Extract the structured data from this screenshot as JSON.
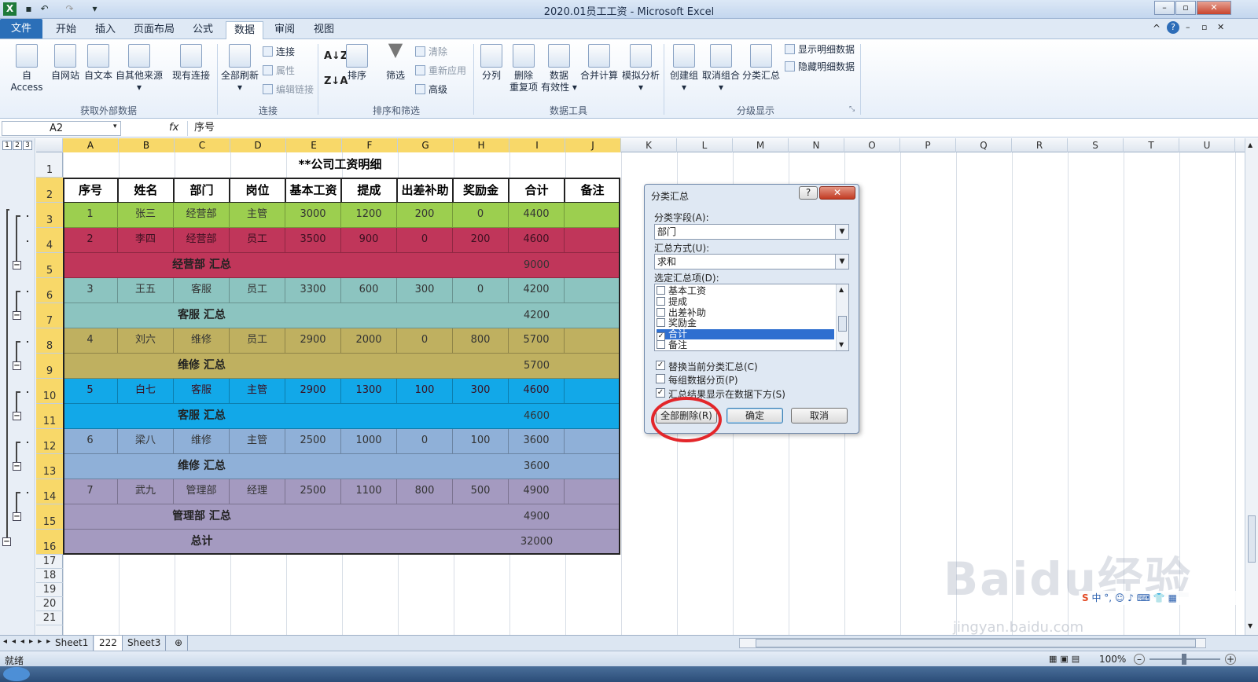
{
  "window": {
    "title": "2020.01员工工资 - Microsoft Excel"
  },
  "tabs": [
    "文件",
    "开始",
    "插入",
    "页面布局",
    "公式",
    "数据",
    "审阅",
    "视图"
  ],
  "active_tab": "数据",
  "ribbon": {
    "external": {
      "access": "自 Access",
      "web": "自网站",
      "text": "自文本",
      "other": "自其他来源",
      "existing": "现有连接",
      "group": "获取外部数据"
    },
    "connections": {
      "refresh_all": "全部刷新",
      "connections": "连接",
      "properties": "属性",
      "edit_links": "编辑链接",
      "group": "连接"
    },
    "sort_filter": {
      "sort": "排序",
      "filter": "筛选",
      "clear": "清除",
      "reapply": "重新应用",
      "advanced": "高级",
      "group": "排序和筛选"
    },
    "data_tools": {
      "split": "分列",
      "remove_dup_1": "删除",
      "remove_dup_2": "重复项",
      "valid_1": "数据",
      "valid_2": "有效性",
      "consolidate": "合并计算",
      "whatif": "模拟分析",
      "group": "数据工具"
    },
    "outline": {
      "group_btn": "创建组",
      "ungroup": "取消组合",
      "subtotal": "分类汇总",
      "show_detail": "显示明细数据",
      "hide_detail": "隐藏明细数据",
      "group": "分级显示"
    }
  },
  "formula_bar": {
    "name_box": "A2",
    "fx": "fx",
    "value": "序号"
  },
  "outline_levels": [
    "1",
    "2",
    "3"
  ],
  "columns": [
    "A",
    "B",
    "C",
    "D",
    "E",
    "F",
    "G",
    "H",
    "I",
    "J",
    "K",
    "L",
    "M",
    "N",
    "O",
    "P",
    "Q",
    "R",
    "S",
    "T",
    "U"
  ],
  "rows": [
    "1",
    "2",
    "3",
    "4",
    "5",
    "6",
    "7",
    "8",
    "9",
    "10",
    "11",
    "12",
    "13",
    "14",
    "15",
    "16",
    "17",
    "18",
    "19",
    "20",
    "21"
  ],
  "sheet": {
    "title": "**公司工资明细",
    "headers": [
      "序号",
      "姓名",
      "部门",
      "岗位",
      "基本工资",
      "提成",
      "出差补助",
      "奖励金",
      "合计",
      "备注"
    ],
    "data_rows": [
      {
        "cells": [
          "1",
          "张三",
          "经营部",
          "主管",
          "3000",
          "1200",
          "200",
          "0",
          "4400",
          ""
        ],
        "color": "#9ccf4f"
      },
      {
        "cells": [
          "2",
          "李四",
          "经营部",
          "员工",
          "3500",
          "900",
          "0",
          "200",
          "4600",
          ""
        ],
        "color": "#c0365a"
      },
      {
        "subtotal": "经营部 汇总",
        "total": "9000",
        "color": "#c0365a"
      },
      {
        "cells": [
          "3",
          "王五",
          "客服",
          "员工",
          "3300",
          "600",
          "300",
          "0",
          "4200",
          ""
        ],
        "color": "#8cc4c0"
      },
      {
        "subtotal": "客服 汇总",
        "total": "4200",
        "color": "#8cc4c0"
      },
      {
        "cells": [
          "4",
          "刘六",
          "维修",
          "员工",
          "2900",
          "2000",
          "0",
          "800",
          "5700",
          ""
        ],
        "color": "#bfb060"
      },
      {
        "subtotal": "维修 汇总",
        "total": "5700",
        "color": "#bfb060"
      },
      {
        "cells": [
          "5",
          "白七",
          "客服",
          "主管",
          "2900",
          "1300",
          "100",
          "300",
          "4600",
          ""
        ],
        "color": "#12a8e8"
      },
      {
        "subtotal": "客服 汇总",
        "total": "4600",
        "color": "#12a8e8"
      },
      {
        "cells": [
          "6",
          "梁八",
          "维修",
          "主管",
          "2500",
          "1000",
          "0",
          "100",
          "3600",
          ""
        ],
        "color": "#8fb0d8"
      },
      {
        "subtotal": "维修 汇总",
        "total": "3600",
        "color": "#8fb0d8"
      },
      {
        "cells": [
          "7",
          "武九",
          "管理部",
          "经理",
          "2500",
          "1100",
          "800",
          "500",
          "4900",
          ""
        ],
        "color": "#a49ac0"
      },
      {
        "subtotal": "管理部 汇总",
        "total": "4900",
        "color": "#a49ac0"
      },
      {
        "subtotal": "总计",
        "total": "32000",
        "color": "#a49ac0"
      }
    ]
  },
  "dialog": {
    "title": "分类汇总",
    "help": "?",
    "close": "✕",
    "field_label": "分类字段(A):",
    "field_value": "部门",
    "method_label": "汇总方式(U):",
    "method_value": "求和",
    "items_label": "选定汇总项(D):",
    "items": [
      {
        "label": "基本工资",
        "checked": false
      },
      {
        "label": "提成",
        "checked": false
      },
      {
        "label": "出差补助",
        "checked": false
      },
      {
        "label": "奖励金",
        "checked": false
      },
      {
        "label": "合计",
        "checked": true
      },
      {
        "label": "备注",
        "checked": false
      }
    ],
    "replace_label": "替换当前分类汇总(C)",
    "page_break_label": "每组数据分页(P)",
    "summary_below_label": "汇总结果显示在数据下方(S)",
    "remove_all": "全部删除(R)",
    "ok": "确定",
    "cancel": "取消"
  },
  "sheet_tabs": [
    "Sheet1",
    "222",
    "Sheet3"
  ],
  "status": {
    "ready": "就绪",
    "zoom": "100%"
  },
  "watermark": {
    "brand": "Baidu经验",
    "url": "jingyan.baidu.com"
  }
}
